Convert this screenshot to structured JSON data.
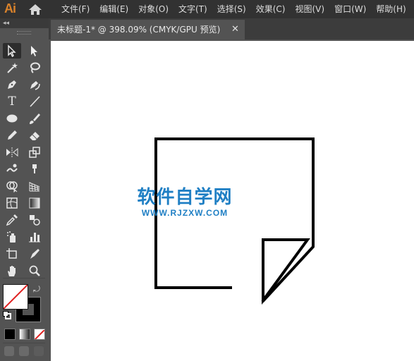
{
  "app": {
    "logo": "Ai"
  },
  "menubar": {
    "items": [
      "文件(F)",
      "编辑(E)",
      "对象(O)",
      "文字(T)",
      "选择(S)",
      "效果(C)",
      "视图(V)",
      "窗口(W)",
      "帮助(H)"
    ]
  },
  "tab": {
    "title": "未标题-1* @ 398.09% (CMYK/GPU 预览)",
    "close": "✕"
  },
  "toolbar": {
    "collapse": "◂◂",
    "tools": [
      "selection-tool-icon",
      "direct-selection-tool-icon",
      "magic-wand-tool-icon",
      "lasso-tool-icon",
      "pen-tool-icon",
      "curvature-tool-icon",
      "type-tool-icon",
      "line-segment-tool-icon",
      "ellipse-tool-icon",
      "paintbrush-tool-icon",
      "pencil-tool-icon",
      "eraser-tool-icon",
      "rotate-tool-icon",
      "scale-tool-icon",
      "reflect-tool-icon",
      "free-transform-tool-icon",
      "warp-tool-icon",
      "puppet-warp-tool-icon",
      "shape-builder-tool-icon",
      "perspective-grid-tool-icon",
      "mesh-tool-icon",
      "gradient-tool-icon",
      "eyedropper-tool-icon",
      "blend-tool-icon",
      "symbol-sprayer-tool-icon",
      "column-graph-tool-icon",
      "artboard-tool-icon",
      "slice-tool-icon",
      "hand-tool-icon",
      "zoom-tool-icon"
    ],
    "type_glyph": "T"
  },
  "colors": {
    "fill": "none",
    "stroke": "#000000",
    "accent_logo": "#d9822b",
    "watermark": "#1f7fc4"
  },
  "watermark": {
    "title": "软件自学网",
    "url": "WWW.RJZXW.COM"
  }
}
